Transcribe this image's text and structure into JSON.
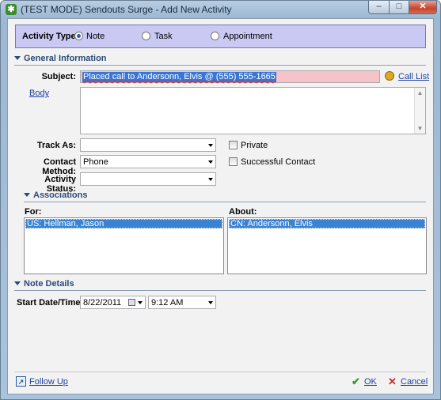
{
  "window": {
    "title": "(TEST MODE) Sendouts Surge - Add New Activity",
    "controls": {
      "minimize": "–",
      "maximize": "□",
      "close": "✕"
    }
  },
  "activity_type": {
    "label": "Activity Type:",
    "options": [
      "Note",
      "Task",
      "Appointment"
    ],
    "selected": "Note"
  },
  "general_information": {
    "header": "General Information",
    "subject_label": "Subject:",
    "subject_value": "Placed call to Andersonn, Elvis @ (555) 555-1665",
    "call_list_link": "Call List",
    "body_link": "Body",
    "body_value": "",
    "track_as_label": "Track As:",
    "track_as_value": "",
    "private_label": "Private",
    "contact_method_label": "Contact Method:",
    "contact_method_value": "Phone",
    "successful_contact_label": "Successful Contact",
    "activity_status_label": "Activity Status:",
    "activity_status_value": ""
  },
  "associations": {
    "header": "Associations",
    "for_label": "For:",
    "for_items": [
      "US: Hellman, Jason"
    ],
    "about_label": "About:",
    "about_items": [
      "CN: Andersonn, Elvis"
    ]
  },
  "note_details": {
    "header": "Note Details",
    "start_label": "Start Date/Time:",
    "date_value": "8/22/2011",
    "time_value": "9:12 AM"
  },
  "footer": {
    "follow_up": "Follow Up",
    "ok": "OK",
    "cancel": "Cancel"
  },
  "colors": {
    "activity_bar": "#c9c9f4",
    "subject_highlight": "#f7c3cb",
    "selection": "#3a83d4",
    "ok_check": "#3a9a2a",
    "cancel_x": "#c03030",
    "link": "#1f3fa0"
  },
  "icons": {
    "app": "sendouts-app-icon",
    "call_list": "phone-icon",
    "calendar": "calendar-icon",
    "follow_up": "follow-up-icon",
    "ok": "checkmark-icon",
    "cancel": "x-icon"
  }
}
